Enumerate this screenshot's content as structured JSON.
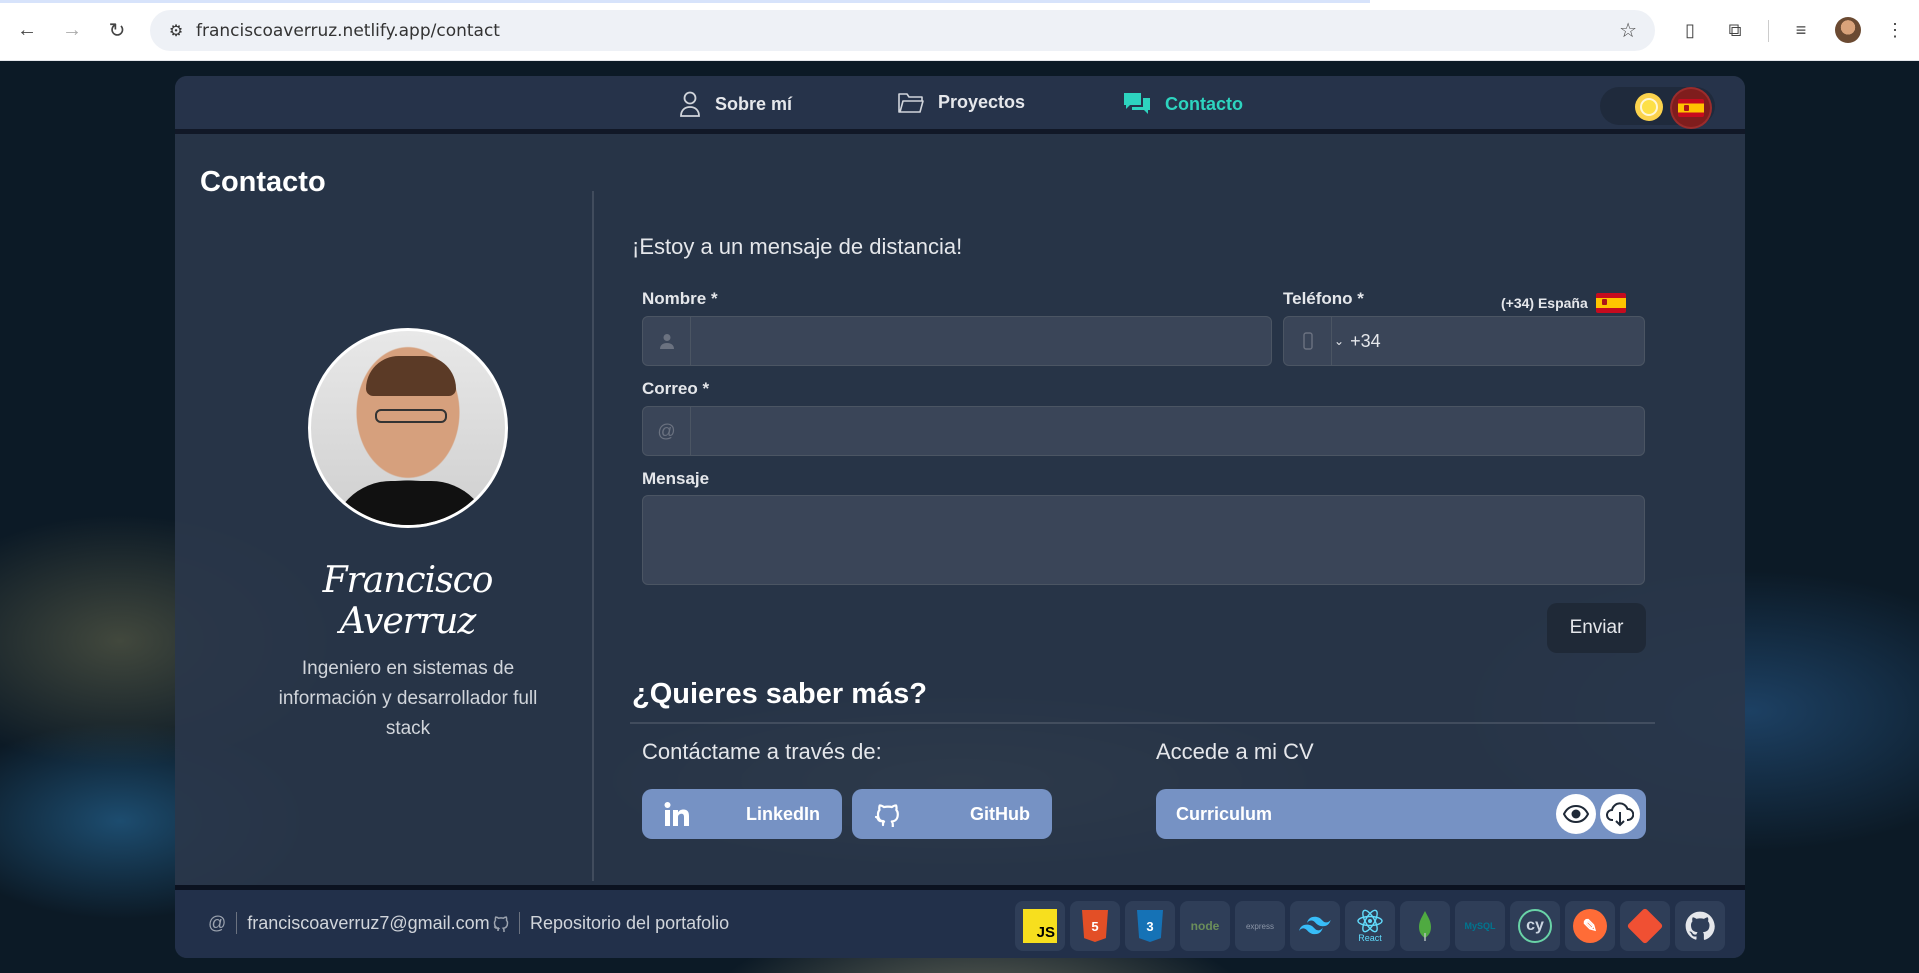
{
  "browser": {
    "url": "franciscoaverruz.netlify.app/contact"
  },
  "nav": {
    "items": [
      {
        "label": "Sobre mí",
        "icon": "user-icon"
      },
      {
        "label": "Proyectos",
        "icon": "folder-icon"
      },
      {
        "label": "Contacto",
        "icon": "chat-icon"
      }
    ],
    "theme_icon": "sun-icon",
    "language_icon": "spain-flag-icon"
  },
  "page": {
    "title": "Contacto"
  },
  "profile": {
    "name": "Francisco Averruz",
    "role": "Ingeniero en sistemas de información y desarrollador full stack"
  },
  "form": {
    "subtitle": "¡Estoy a un mensaje de distancia!",
    "name_label": "Nombre *",
    "phone_label": "Teléfono *",
    "country": "(+34) España",
    "phone_prefix": "+34",
    "email_label": "Correo *",
    "email_adorn": "@",
    "message_label": "Mensaje",
    "send_label": "Enviar"
  },
  "more": {
    "title": "¿Quieres saber más?",
    "contact_title": "Contáctame a través de:",
    "linkedin": "LinkedIn",
    "github": "GitHub",
    "cv_title": "Accede a mi CV",
    "cv_label": "Curriculum"
  },
  "footer": {
    "email": "franciscoaverruz7@gmail.com",
    "email_icon": "@",
    "repo": "Repositorio del portafolio",
    "tech": [
      {
        "name": "JS",
        "icon": "javascript-icon"
      },
      {
        "name": "HTML",
        "icon": "html5-icon"
      },
      {
        "name": "CSS",
        "icon": "css3-icon"
      },
      {
        "name": "node",
        "icon": "nodejs-icon"
      },
      {
        "name": "express",
        "icon": "express-icon"
      },
      {
        "name": "tailwind",
        "icon": "tailwind-icon"
      },
      {
        "name": "React",
        "icon": "react-icon"
      },
      {
        "name": "DB",
        "icon": "mongodb-icon"
      },
      {
        "name": "MySQL",
        "icon": "mysql-icon"
      },
      {
        "name": "cy",
        "icon": "cypress-icon"
      },
      {
        "name": "postman",
        "icon": "postman-icon"
      },
      {
        "name": "git",
        "icon": "git-icon"
      },
      {
        "name": "github",
        "icon": "github-icon"
      }
    ]
  }
}
